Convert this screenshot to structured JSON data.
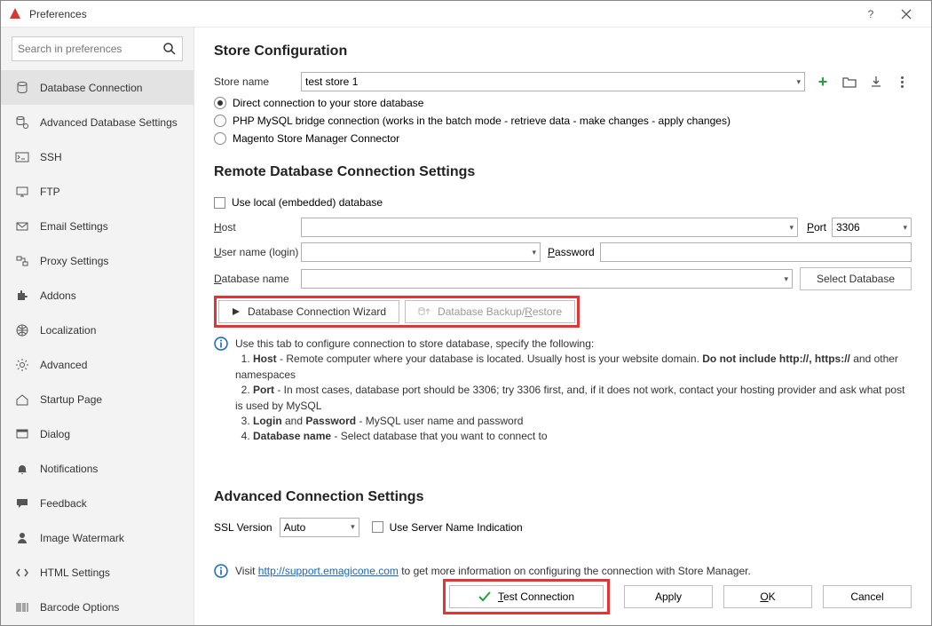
{
  "window": {
    "title": "Preferences"
  },
  "search": {
    "placeholder": "Search in preferences"
  },
  "sidebar": {
    "items": [
      {
        "label": "Database Connection"
      },
      {
        "label": "Advanced Database Settings"
      },
      {
        "label": "SSH"
      },
      {
        "label": "FTP"
      },
      {
        "label": "Email Settings"
      },
      {
        "label": "Proxy Settings"
      },
      {
        "label": "Addons"
      },
      {
        "label": "Localization"
      },
      {
        "label": "Advanced"
      },
      {
        "label": "Startup Page"
      },
      {
        "label": "Dialog"
      },
      {
        "label": "Notifications"
      },
      {
        "label": "Feedback"
      },
      {
        "label": "Image Watermark"
      },
      {
        "label": "HTML Settings"
      },
      {
        "label": "Barcode Options"
      }
    ]
  },
  "store": {
    "heading": "Store Configuration",
    "name_label": "Store name",
    "name_value": "test store 1",
    "radios": {
      "direct": "Direct connection to your store database",
      "bridge": "PHP MySQL bridge connection (works in the batch mode - retrieve data - make changes - apply changes)",
      "connector": "Magento Store Manager Connector"
    }
  },
  "remote": {
    "heading": "Remote Database Connection Settings",
    "use_local": "Use local (embedded) database",
    "host_label": "Host",
    "port_label": "Port",
    "port_value": "3306",
    "user_label": "User name (login)",
    "pass_label": "Password",
    "db_label": "Database name",
    "select_db": "Select Database",
    "wizard": "Database Connection Wizard",
    "backup": "Database Backup/Restore"
  },
  "help_intro": "Use this tab to configure connection to store database, specify the following:",
  "help": {
    "host_pre": "1. ",
    "host_b": "Host",
    "host_txt": " - Remote computer where your database is located. Usually host is your website domain. ",
    "host_b2": "Do not include http://, https://",
    "host_after": " and other namespaces",
    "port_pre": "2. ",
    "port_b": "Port",
    "port_txt": " - In most cases, database port should be 3306; try 3306 first, and, if it does not work, contact your hosting provider and ask what post is used by MySQL",
    "login_pre": "3. ",
    "login_b1": "Login",
    "login_and": " and ",
    "login_b2": "Password",
    "login_txt": " - MySQL user name and password",
    "db_pre": "4. ",
    "db_b": "Database name",
    "db_txt": " - Select database that you want to connect to"
  },
  "advanced": {
    "heading": "Advanced Connection Settings",
    "ssl_label": "SSL Version",
    "ssl_value": "Auto",
    "sni": "Use Server Name Indication"
  },
  "visit": {
    "pre": "Visit ",
    "link": "http://support.emagicone.com",
    "post": " to get more information on configuring the connection with Store Manager."
  },
  "buttons": {
    "test": "Test Connection",
    "apply": "Apply",
    "ok": "OK",
    "cancel": "Cancel"
  }
}
